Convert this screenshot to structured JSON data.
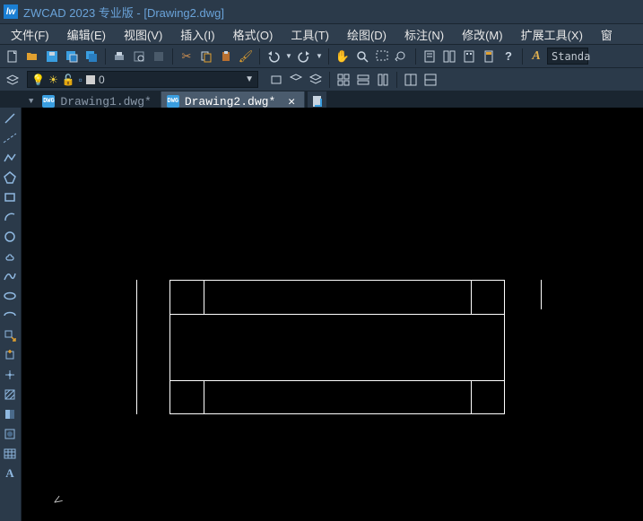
{
  "title": "ZWCAD 2023 专业版 - [Drawing2.dwg]",
  "menu": {
    "file": "文件(F)",
    "edit": "编辑(E)",
    "view": "视图(V)",
    "insert": "插入(I)",
    "format": "格式(O)",
    "tools": "工具(T)",
    "draw": "绘图(D)",
    "dim": "标注(N)",
    "modify": "修改(M)",
    "express": "扩展工具(X)",
    "extra": "窗"
  },
  "layer": {
    "current": "0"
  },
  "textstyle": {
    "current": "Standa"
  },
  "dimstyle_label": "A",
  "tabs": [
    {
      "name": "Drawing1.dwg*",
      "active": false
    },
    {
      "name": "Drawing2.dwg*",
      "active": true
    }
  ]
}
